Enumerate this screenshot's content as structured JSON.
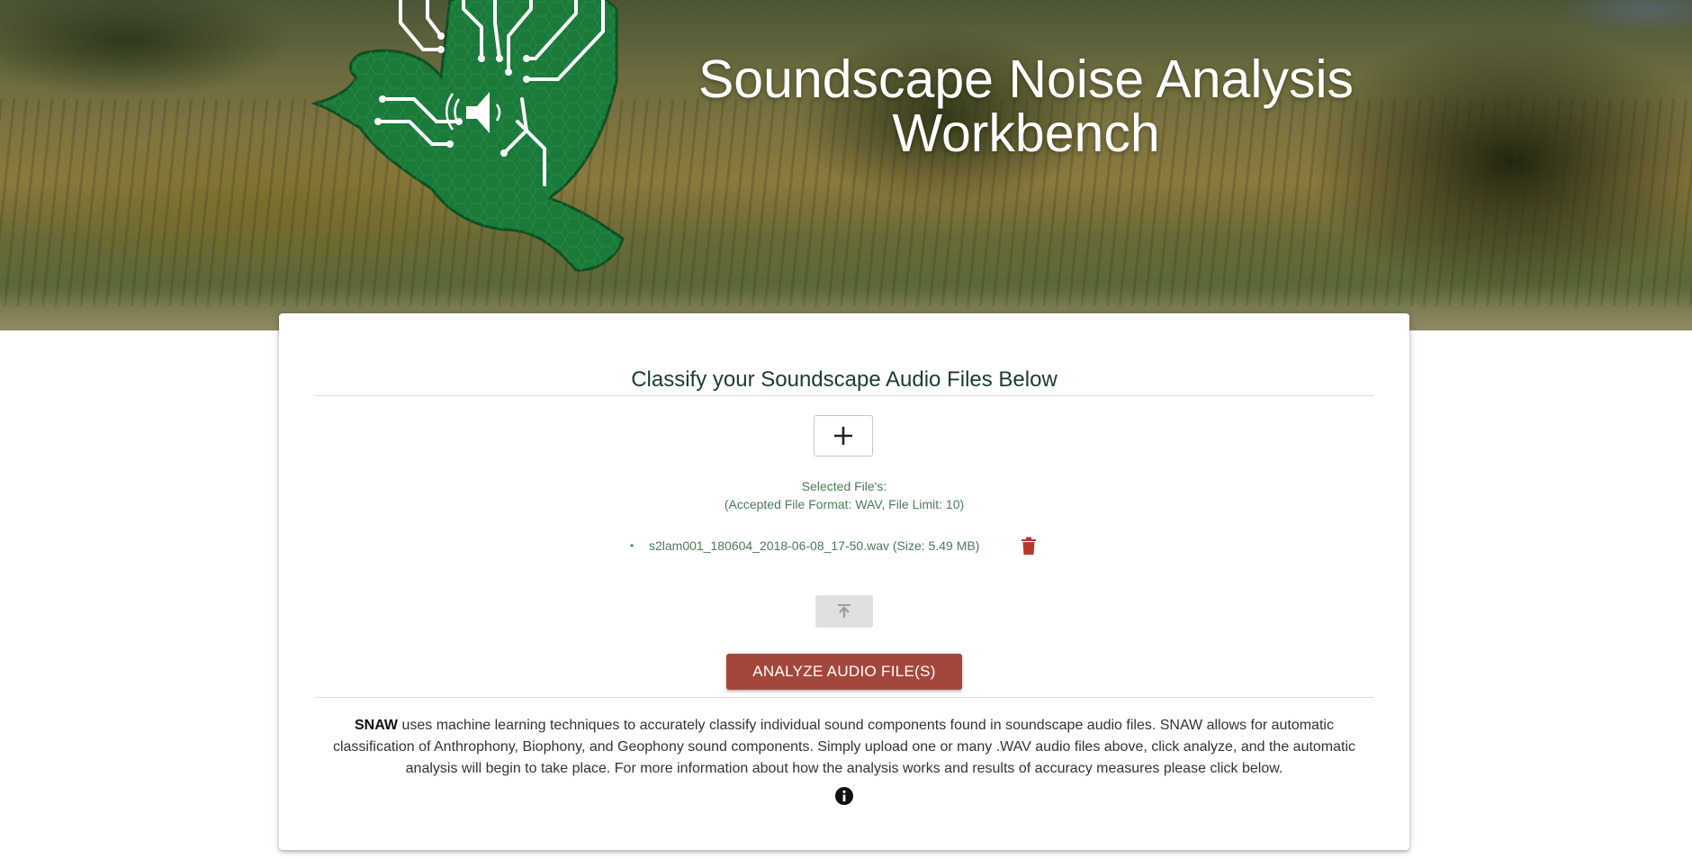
{
  "header": {
    "title_line1": "Soundscape Noise Analysis",
    "title_line2": "Workbench",
    "logo_icon": "bird-circuit-logo-icon"
  },
  "classifier": {
    "heading": "Classify your Soundscape Audio Files Below",
    "add_icon": "plus-icon",
    "selected_label": "Selected File's:",
    "format_note": "(Accepted File Format: WAV, File Limit: 10)",
    "files": [
      {
        "name": "s2lam001_180604_2018-06-08_17-50.wav (Size: 5.49 MB)",
        "delete_icon": "trash-icon"
      }
    ],
    "upload_icon": "upload-icon",
    "analyze_label": "ANALYZE AUDIO FILE(S)",
    "description_strong": "SNAW",
    "description_rest": " uses machine learning techniques to accurately classify individual sound components found in soundscape audio files. SNAW allows for automatic classification of Anthrophony, Biophony, and Geophony sound components. Simply upload one or many .WAV audio files above, click analyze, and the automatic analysis will begin to take place. For more information about how the analysis works and results of accuracy measures please click below.",
    "info_icon": "info-icon"
  },
  "colors": {
    "accent_red": "#a4473b",
    "text_green": "#4b7a58",
    "heading_green": "#1c3d2a",
    "logo_green": "#1a7a3a"
  }
}
